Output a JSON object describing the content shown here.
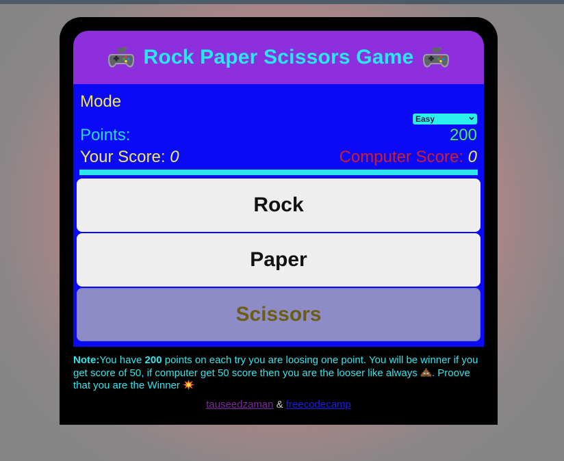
{
  "header": {
    "title": "Rock Paper Scissors Game",
    "left_icon": "gamepad-icon",
    "right_icon": "gamepad-icon"
  },
  "mode": {
    "label": "Mode",
    "selected": "Easy"
  },
  "points": {
    "label": "Points:",
    "value": "200"
  },
  "scores": {
    "your_label": "Your Score:",
    "your_value": "0",
    "computer_label": "Computer Score:",
    "computer_value": "0"
  },
  "choices": {
    "rock": "Rock",
    "paper": "Paper",
    "scissors": "Scissors"
  },
  "note": {
    "label": "Note:",
    "text1": "You have ",
    "points": "200",
    "text2": " points on each try you are loosing one point. You will be winner if you get score of 50, if computer get 50 score then you are the looser like always ",
    "text3": ". Proove that you are the Winner ",
    "icon1": "poop-icon",
    "icon2": "collision-icon"
  },
  "footer": {
    "link1": "tauseedzaman",
    "separator": " & ",
    "link2": "freecodecamp"
  },
  "colors": {
    "header_bg": "#8e2fdd",
    "title": "#27e8ee",
    "panel_bg": "#0a0af7",
    "mode_label": "#f1e85a",
    "points_label": "#2ad7f0",
    "points_value": "#4fe85a",
    "computer_score": "#cc1f2a",
    "button_bg": "#eeeeef",
    "scissors_bg": "#8d8cc7"
  },
  "progress": {
    "value": 1.0
  }
}
